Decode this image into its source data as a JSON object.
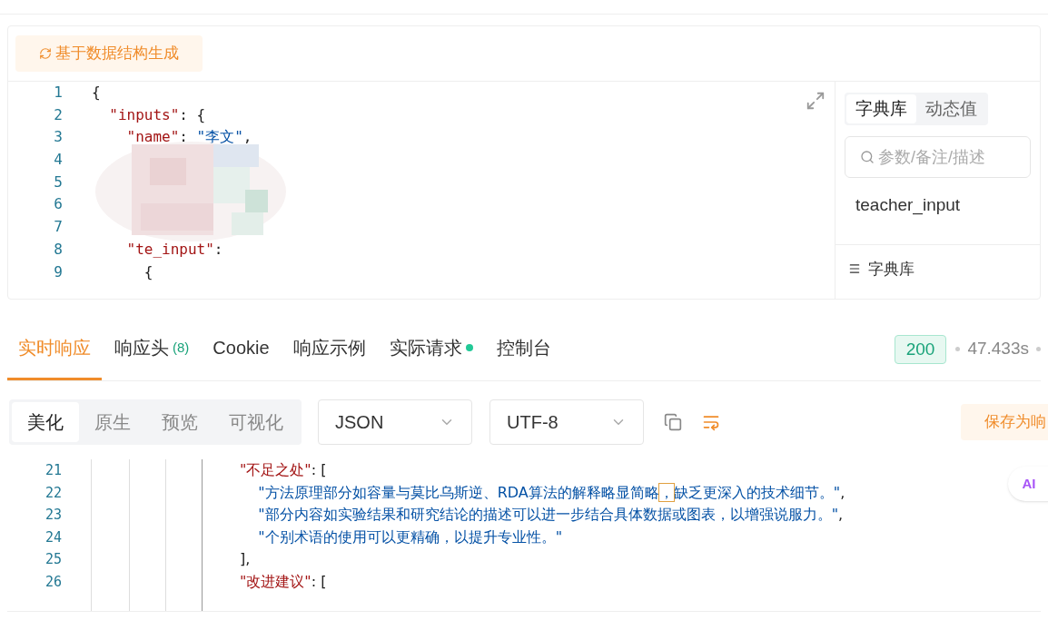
{
  "generate_button": {
    "label": "基于数据结构生成"
  },
  "editor": {
    "lines": [
      {
        "number": "1",
        "tokens": [
          {
            "kind": "punct",
            "text": "{"
          }
        ]
      },
      {
        "number": "2",
        "tokens": [
          {
            "kind": "key",
            "text": "  \"inputs\""
          },
          {
            "kind": "punct",
            "text": ": {"
          }
        ]
      },
      {
        "number": "3",
        "tokens": [
          {
            "kind": "key",
            "text": "    \"name\""
          },
          {
            "kind": "punct",
            "text": ": "
          },
          {
            "kind": "string",
            "text": "\"李文\""
          },
          {
            "kind": "punct",
            "text": ","
          }
        ]
      },
      {
        "number": "4"
      },
      {
        "number": "5"
      },
      {
        "number": "6"
      },
      {
        "number": "7"
      },
      {
        "number": "8",
        "tokens": [
          {
            "kind": "key",
            "text": "    \"te_input\""
          },
          {
            "kind": "punct",
            "text": ":"
          }
        ]
      },
      {
        "number": "9",
        "tokens": [
          {
            "kind": "punct",
            "text": "      {"
          }
        ]
      }
    ]
  },
  "side_panel": {
    "tabs": [
      {
        "label": "字典库",
        "selected": true
      },
      {
        "label": "动态值",
        "selected": false
      }
    ],
    "search": {
      "placeholder": "参数/备注/描述"
    },
    "item": "teacher_input",
    "footer": "字典库"
  },
  "response": {
    "tabs": [
      {
        "label": "实时响应",
        "selected": true
      },
      {
        "label": "响应头",
        "count": "(8)",
        "selected": false
      },
      {
        "label": "Cookie",
        "selected": false
      },
      {
        "label": "响应示例",
        "selected": false
      },
      {
        "label": "实际请求",
        "dot": true,
        "selected": false
      },
      {
        "label": "控制台",
        "selected": false
      }
    ],
    "status": "200",
    "time": "47.433s",
    "views": [
      {
        "label": "美化",
        "selected": true
      },
      {
        "label": "原生",
        "selected": false
      },
      {
        "label": "预览",
        "selected": false
      },
      {
        "label": "可视化",
        "selected": false
      }
    ],
    "format": "JSON",
    "encoding": "UTF-8",
    "save_button": "保存为响",
    "lines": [
      {
        "number": "21",
        "tokens": [
          {
            "kind": "key",
            "text": "\"不足之处\""
          },
          {
            "kind": "punct",
            "text": ": ["
          }
        ]
      },
      {
        "number": "22",
        "tokens": [
          {
            "kind": "string",
            "text": "    \"方法原理部分如容量与莫比乌斯逆、RDA算法的解释略显简略"
          },
          {
            "kind": "cursor",
            "text": "，"
          },
          {
            "kind": "string",
            "text": "缺乏更深入的技术细节。\""
          },
          {
            "kind": "punct",
            "text": ","
          }
        ]
      },
      {
        "number": "23",
        "tokens": [
          {
            "kind": "string",
            "text": "    \"部分内容如实验结果和研究结论的描述可以进一步结合具体数据或图表，以增强说服力。\""
          },
          {
            "kind": "punct",
            "text": ","
          }
        ]
      },
      {
        "number": "24",
        "tokens": [
          {
            "kind": "string",
            "text": "    \"个别术语的使用可以更精确，以提升专业性。\""
          }
        ]
      },
      {
        "number": "25",
        "tokens": [
          {
            "kind": "punct",
            "text": "],"
          }
        ]
      },
      {
        "number": "26",
        "tokens": [
          {
            "kind": "key",
            "text": "\"改进建议\""
          },
          {
            "kind": "punct",
            "text": ": ["
          }
        ]
      }
    ]
  },
  "ai_badge": "AI"
}
